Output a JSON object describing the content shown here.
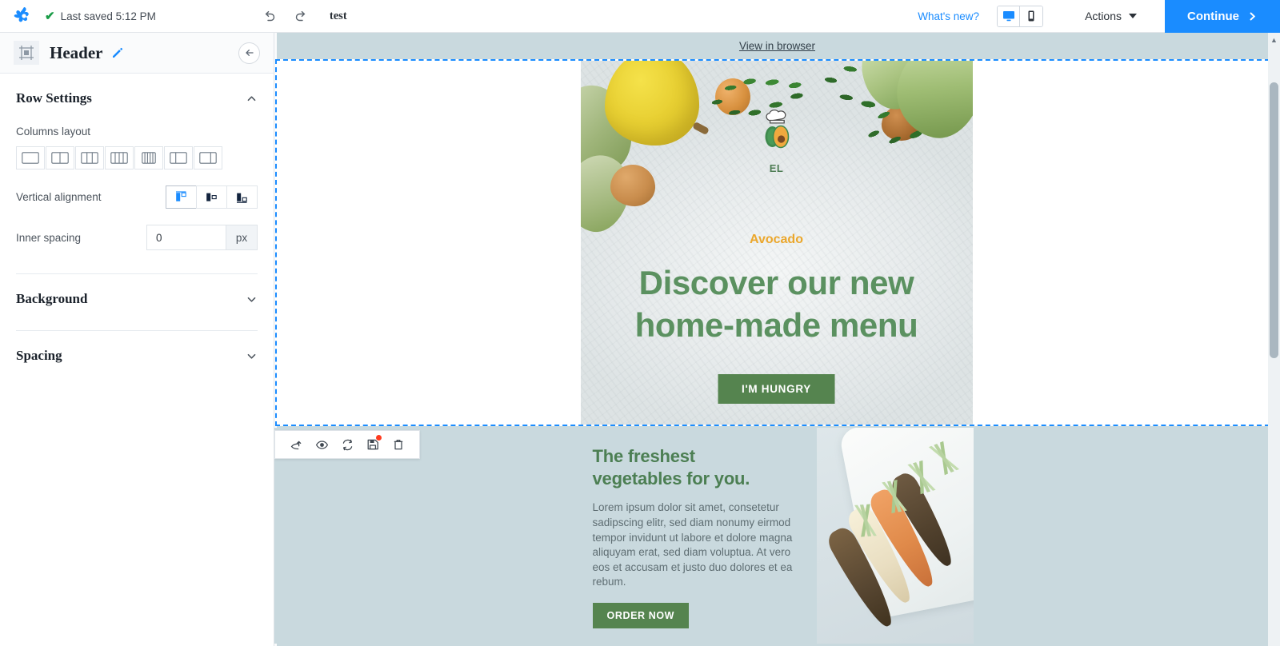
{
  "topbar": {
    "logo_name": "brand-logo",
    "saved_status": "Last saved 5:12 PM",
    "check_icon": "check-icon",
    "undo_icon": "undo-icon",
    "redo_icon": "redo-icon",
    "doc_title": "test",
    "whats_new": "What's new?",
    "desktop_icon": "desktop-icon",
    "mobile_icon": "mobile-icon",
    "actions_label": "Actions",
    "continue_label": "Continue"
  },
  "sidebar": {
    "panel_title": "Header",
    "panel_icon": "row-layout-icon",
    "edit_icon": "pencil-icon",
    "back_icon": "back-arrow-icon",
    "sections": [
      {
        "title": "Row Settings",
        "expanded": true,
        "chevron": "chevron-up-icon"
      },
      {
        "title": "Background",
        "expanded": false,
        "chevron": "chevron-down-icon"
      },
      {
        "title": "Spacing",
        "expanded": false,
        "chevron": "chevron-down-icon"
      }
    ],
    "columns_layout": {
      "label": "Columns layout",
      "options": [
        {
          "name": "one-column",
          "columns": 1,
          "widths": [
            100
          ]
        },
        {
          "name": "two-columns-equal",
          "columns": 2,
          "widths": [
            50,
            50
          ]
        },
        {
          "name": "three-columns-equal",
          "columns": 3,
          "widths": [
            33,
            34,
            33
          ]
        },
        {
          "name": "four-columns-equal",
          "columns": 4,
          "widths": [
            25,
            25,
            25,
            25
          ]
        },
        {
          "name": "five-columns-equal",
          "columns": 5,
          "widths": [
            20,
            20,
            20,
            20,
            20
          ]
        },
        {
          "name": "two-columns-left-narrow",
          "columns": 2,
          "widths": [
            33,
            67
          ]
        },
        {
          "name": "two-columns-right-narrow",
          "columns": 2,
          "widths": [
            67,
            33
          ]
        }
      ]
    },
    "vertical_alignment": {
      "label": "Vertical alignment",
      "options": [
        {
          "name": "align-top",
          "selected": true
        },
        {
          "name": "align-middle",
          "selected": false
        },
        {
          "name": "align-bottom",
          "selected": false
        }
      ]
    },
    "inner_spacing": {
      "label": "Inner spacing",
      "value": "0",
      "placeholder": "0",
      "unit": "px"
    }
  },
  "canvas": {
    "view_in_browser": "View in browser",
    "row_toolbar": [
      {
        "name": "move-row-icon",
        "badge": false
      },
      {
        "name": "eye-preview-icon",
        "badge": false
      },
      {
        "name": "duplicate-row-icon",
        "badge": false
      },
      {
        "name": "save-row-icon",
        "badge": true
      },
      {
        "name": "delete-row-icon",
        "badge": false
      }
    ],
    "hero": {
      "logo_name": "avocado-chef-logo",
      "brand_initials": "EL",
      "brand_name": "Avocado",
      "headline_line1": "Discover our new",
      "headline_line2": "home-made menu",
      "cta_label": "I'M HUNGRY"
    },
    "block2": {
      "title_line1": "The freshest",
      "title_line2": "vegetables for you.",
      "body": "Lorem ipsum dolor sit amet, consetetur sadipscing elitr, sed diam nonumy eirmod tempor invidunt ut labore et dolore magna aliquyam erat, sed diam voluptua. At vero eos et accusam et justo duo dolores et ea rebum.",
      "cta_label": "ORDER NOW",
      "image_name": "carrots-on-plate-image"
    }
  },
  "colors": {
    "accent_blue": "#1a8cff",
    "brand_green": "#5b9160",
    "button_green": "#55844f",
    "brand_orange": "#eba72c",
    "canvas_bg": "#c9d9de",
    "selection_border": "#1a8cff",
    "badge_red": "#ff3b1f"
  }
}
